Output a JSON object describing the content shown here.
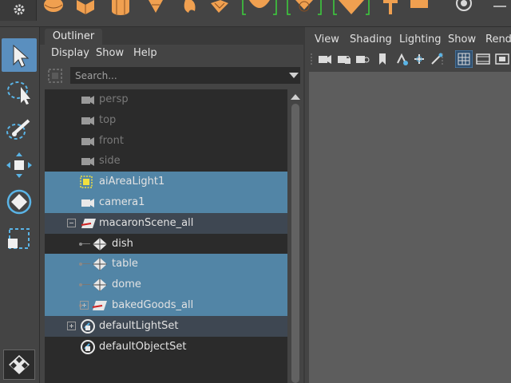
{
  "shelf": {
    "icons": [
      "gear-icon",
      "sphere-icon",
      "cube-icon",
      "cylinder-icon",
      "cone-icon",
      "torus-icon",
      "plane-icon",
      "soccer-ball-icon",
      "helix-icon",
      "pipe-icon",
      "prism-icon",
      "text-icon",
      "light-icon"
    ],
    "accent": "#f0a050",
    "bracket_color": "#3cd23c"
  },
  "toolbox": {
    "tools": [
      "select-tool",
      "lasso-tool",
      "paint-select-tool",
      "move-tool",
      "rotate-tool",
      "scale-tool"
    ],
    "active_color": "#5a8fbf"
  },
  "outliner": {
    "tab_label": "Outliner",
    "menus": [
      "Display",
      "Show",
      "Help"
    ],
    "search_placeholder": "Search...",
    "items": [
      {
        "label": "persp",
        "type": "camera",
        "state": "dim"
      },
      {
        "label": "top",
        "type": "camera",
        "state": "dim"
      },
      {
        "label": "front",
        "type": "camera",
        "state": "dim"
      },
      {
        "label": "side",
        "type": "camera",
        "state": "dim"
      },
      {
        "label": "aiAreaLight1",
        "type": "light",
        "state": "selected"
      },
      {
        "label": "camera1",
        "type": "camera",
        "state": "selected"
      },
      {
        "label": "macaronScene_all",
        "type": "set",
        "state": "child-selected",
        "expanded": true
      },
      {
        "label": "dish",
        "type": "mesh",
        "state": "normal"
      },
      {
        "label": "table",
        "type": "mesh",
        "state": "selected"
      },
      {
        "label": "dome",
        "type": "mesh",
        "state": "selected"
      },
      {
        "label": "bakedGoods_all",
        "type": "set",
        "state": "selected",
        "expanded": false
      },
      {
        "label": "defaultLightSet",
        "type": "objectset",
        "state": "child-selected",
        "expanded": false
      },
      {
        "label": "defaultObjectSet",
        "type": "objectset",
        "state": "normal"
      }
    ],
    "selected_color": "#5285a6",
    "child_selected_color": "#3e4752"
  },
  "viewport": {
    "menus": [
      "View",
      "Shading",
      "Lighting",
      "Show",
      "Rende"
    ]
  }
}
